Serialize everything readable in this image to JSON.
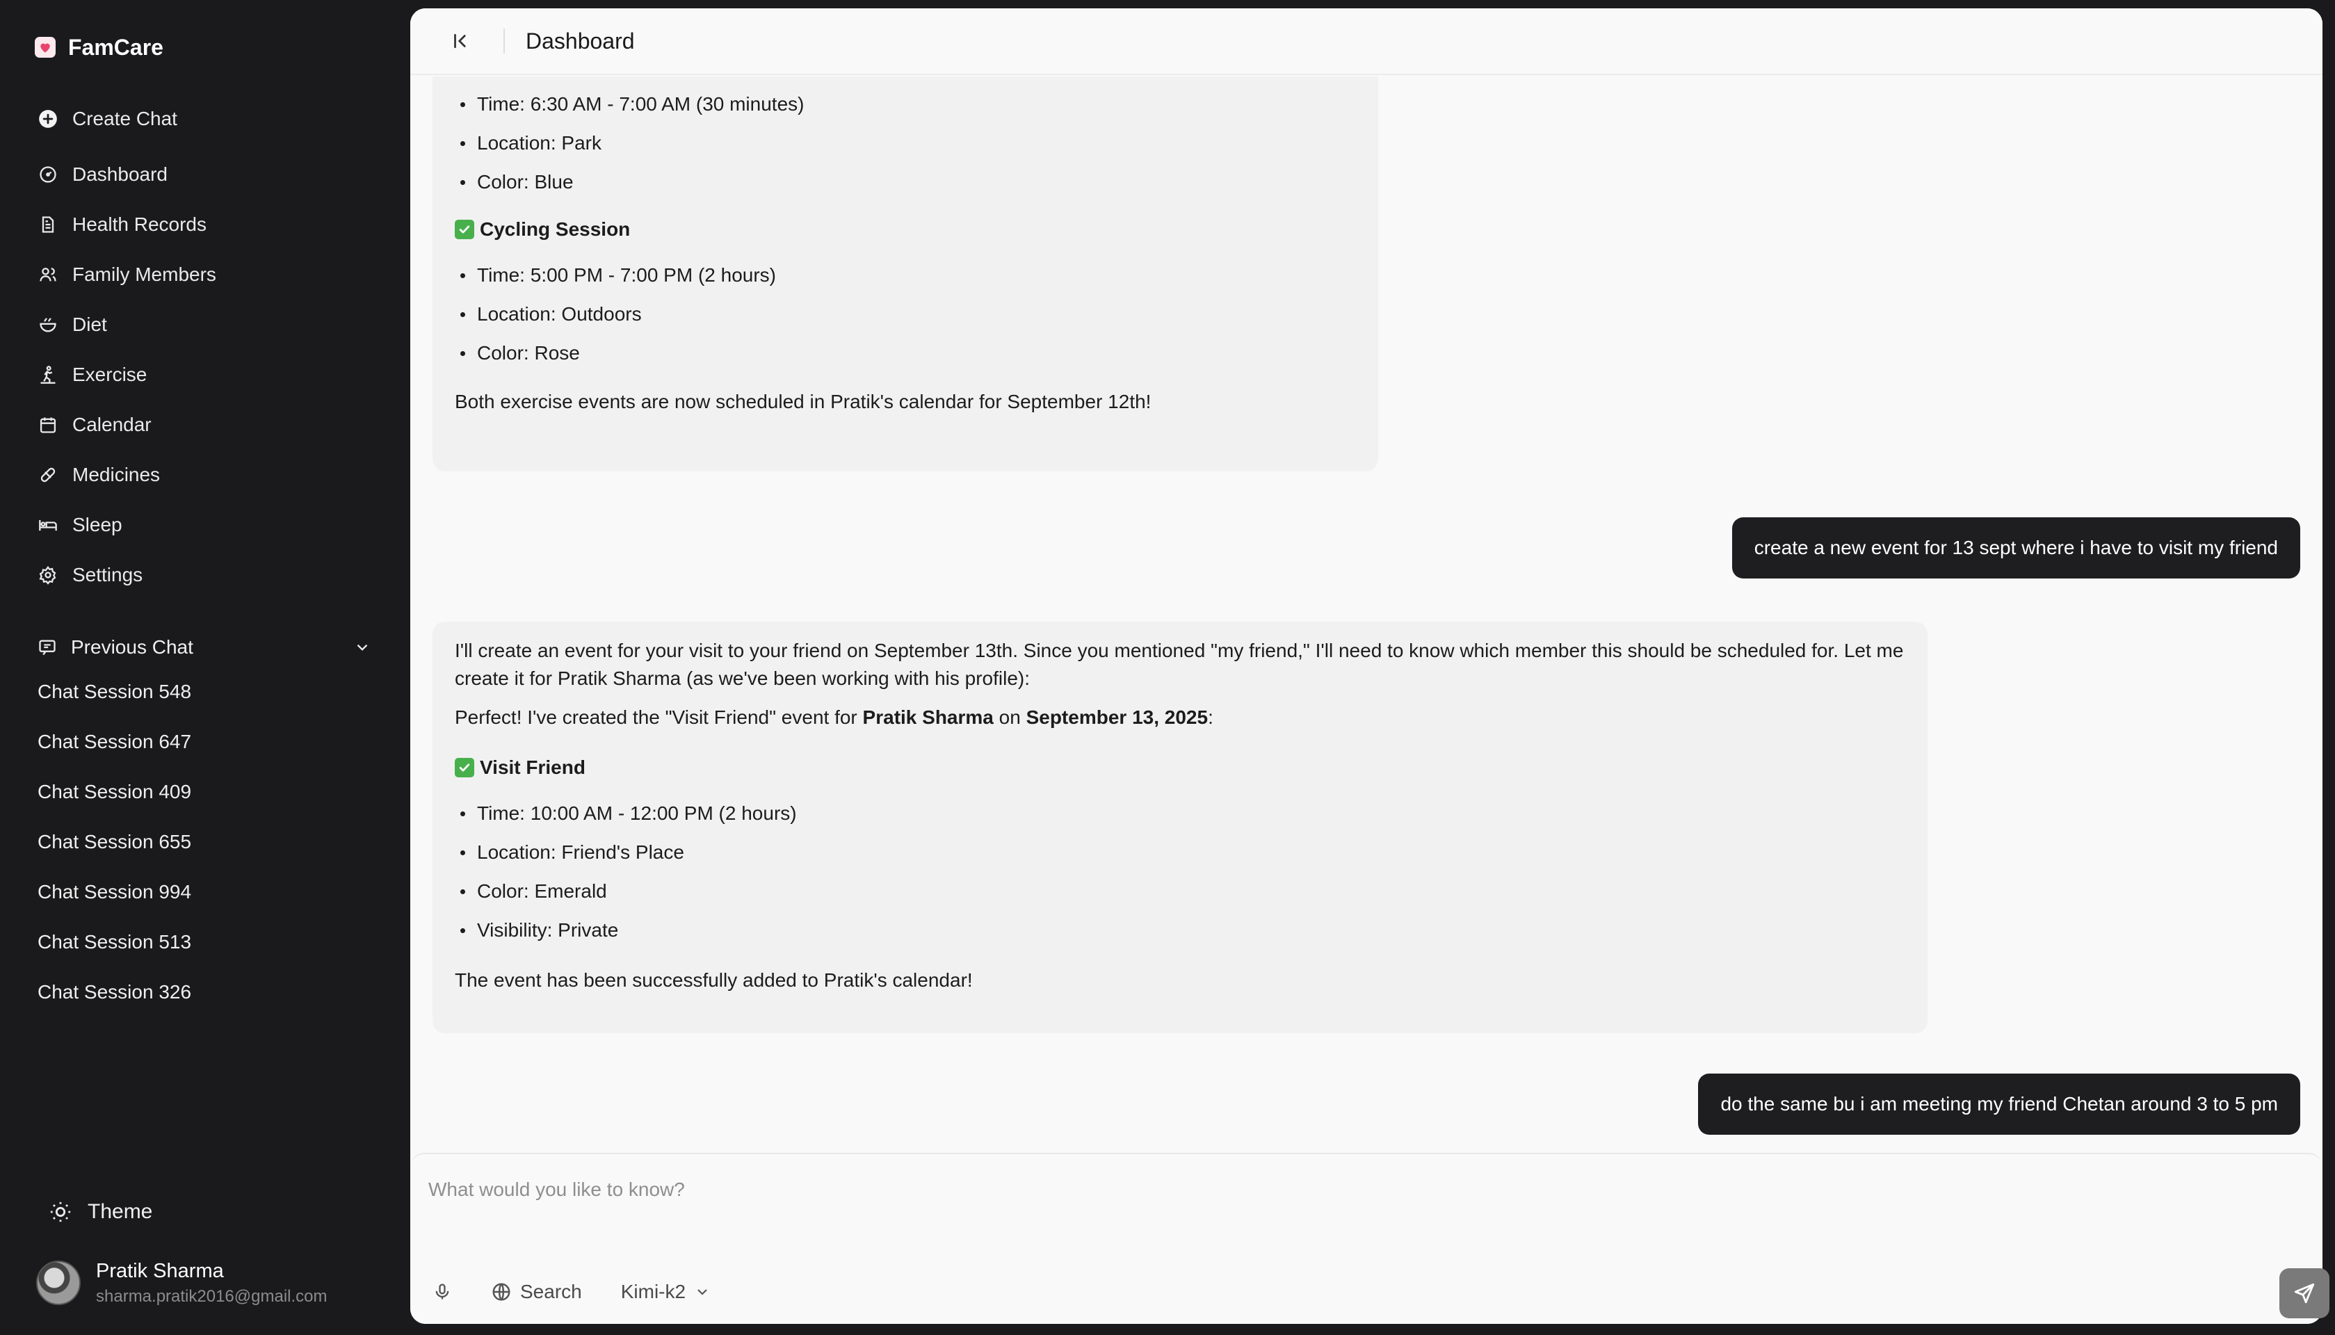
{
  "brand": {
    "name": "FamCare"
  },
  "nav": {
    "create_chat": "Create Chat",
    "items": [
      {
        "label": "Dashboard",
        "icon": "dashboard-icon"
      },
      {
        "label": "Health Records",
        "icon": "document-icon"
      },
      {
        "label": "Family Members",
        "icon": "users-icon"
      },
      {
        "label": "Diet",
        "icon": "bowl-icon"
      },
      {
        "label": "Exercise",
        "icon": "exercise-icon"
      },
      {
        "label": "Calendar",
        "icon": "calendar-icon"
      },
      {
        "label": "Medicines",
        "icon": "pill-icon"
      },
      {
        "label": "Sleep",
        "icon": "bed-icon"
      },
      {
        "label": "Settings",
        "icon": "gear-icon"
      }
    ]
  },
  "previous_chat": {
    "label": "Previous Chat",
    "sessions": [
      "Chat Session 548",
      "Chat Session 647",
      "Chat Session 409",
      "Chat Session 655",
      "Chat Session 994",
      "Chat Session 513",
      "Chat Session 326"
    ]
  },
  "footer": {
    "theme_label": "Theme",
    "user_name": "Pratik Sharma",
    "user_email": "sharma.pratik2016@gmail.com"
  },
  "header": {
    "title": "Dashboard"
  },
  "messages": {
    "m1": {
      "items_top": [
        "Time: 6:30 AM - 7:00 AM (30 minutes)",
        "Location: Park",
        "Color: Blue"
      ],
      "event_title": "Cycling Session",
      "items": [
        "Time: 5:00 PM - 7:00 PM (2 hours)",
        "Location: Outdoors",
        "Color: Rose"
      ],
      "closing": "Both exercise events are now scheduled in Pratik's calendar for September 12th!"
    },
    "u1": "create a new event for 13 sept where i have to visit my friend",
    "m2": {
      "intro": "I'll create an event for your visit to your friend on September 13th. Since you mentioned \"my friend,\" I'll need to know which member this should be scheduled for. Let me create it for Pratik Sharma (as we've been working with his profile):",
      "perfect_prefix": "Perfect! I've created the \"Visit Friend\" event for ",
      "perfect_name": "Pratik Sharma",
      "perfect_on": " on ",
      "perfect_date": "September 13, 2025",
      "perfect_suffix": ":",
      "event_title": "Visit Friend",
      "items": [
        "Time: 10:00 AM - 12:00 PM (2 hours)",
        "Location: Friend's Place",
        "Color: Emerald",
        "Visibility: Private"
      ],
      "closing": "The event has been successfully added to Pratik's calendar!"
    },
    "u2": "do the same bu i am meeting my friend Chetan around 3 to 5 pm"
  },
  "composer": {
    "placeholder": "What would you like to know?",
    "search_label": "Search",
    "model_label": "Kimi-k2"
  },
  "colors": {
    "sidebar_bg": "#1a1a1c",
    "main_bg": "#f9f9f9",
    "user_bubble": "#1e1e20",
    "ai_bubble": "#f1f1f1",
    "check_green": "#47b04b"
  }
}
